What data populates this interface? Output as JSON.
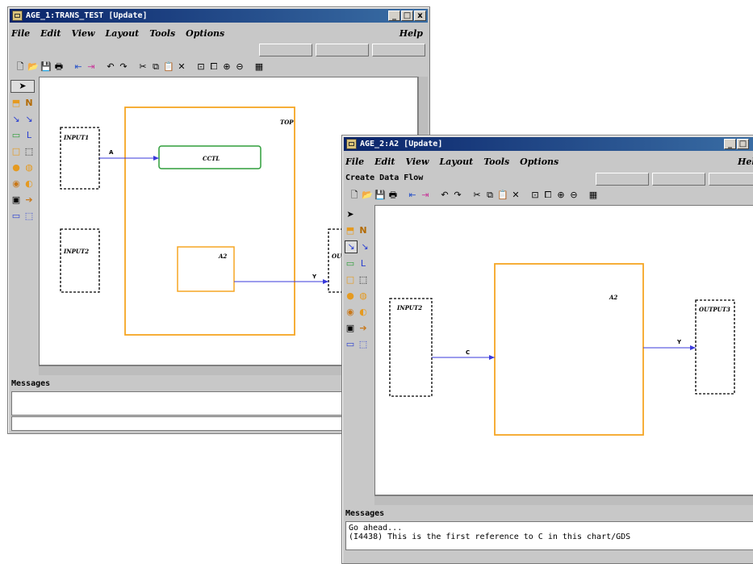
{
  "window1": {
    "title": "AGE_1:TRANS_TEST  [Update]",
    "menu": [
      "File",
      "Edit",
      "View",
      "Layout",
      "Tools",
      "Options"
    ],
    "help": "Help",
    "messages_label": "Messages",
    "diagram": {
      "blocks": {
        "input1": "INPUT1",
        "input2": "INPUT2",
        "top": "TOP",
        "ctl": "CCTL",
        "a2": "A2",
        "out_partial": "OU"
      },
      "arrows": {
        "a": "A",
        "y": "Y"
      }
    }
  },
  "window2": {
    "title": "AGE_2:A2  [Update]",
    "menu": [
      "File",
      "Edit",
      "View",
      "Layout",
      "Tools",
      "Options"
    ],
    "help": "Help",
    "subtitle": "Create Data Flow",
    "messages_label": "Messages",
    "messages": [
      "Go ahead...",
      "(I4438) This is the first reference to C in this chart/GDS"
    ],
    "diagram": {
      "blocks": {
        "input2": "INPUT2",
        "a2": "A2",
        "output3": "OUTPUT3"
      },
      "arrows": {
        "c": "C",
        "y": "Y"
      }
    }
  },
  "window_buttons": {
    "minimize": "_",
    "maximize": "□",
    "close": "x"
  },
  "colors": {
    "state_orange": "#f5a623",
    "state_green": "#2e9e3a",
    "arrow_blue": "#3a3adb",
    "title_blue": "#0a246a"
  }
}
